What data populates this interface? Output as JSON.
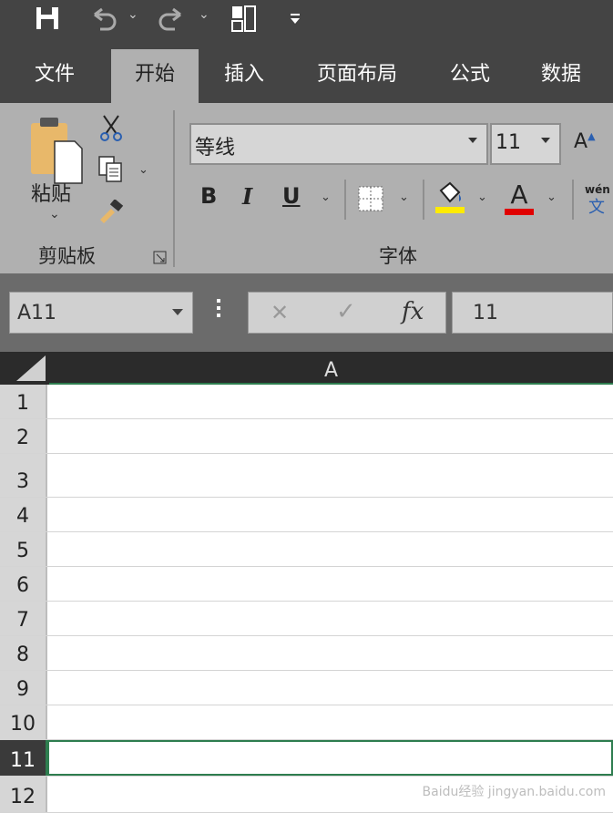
{
  "tabs": [
    {
      "label": "文件"
    },
    {
      "label": "开始"
    },
    {
      "label": "插入"
    },
    {
      "label": "页面布局"
    },
    {
      "label": "公式"
    },
    {
      "label": "数据"
    }
  ],
  "ribbon": {
    "clipboard": {
      "paste_label": "粘贴",
      "group_label": "剪贴板"
    },
    "font": {
      "font_name": "等线",
      "font_size": "11",
      "group_label": "字体",
      "bold": "B",
      "italic": "I",
      "underline": "U",
      "fill_color": "#ffeb00",
      "font_color": "#e00000",
      "font_color_letter": "A",
      "grow_font_letter": "A",
      "phonetic_top": "wén",
      "phonetic_bottom": "文"
    }
  },
  "formula_bar": {
    "name_box": "A11",
    "cancel": "✕",
    "enter": "✓",
    "fx": "fx",
    "value": "11"
  },
  "sheet": {
    "column_header": "A",
    "rows": [
      "1",
      "2",
      "3",
      "4",
      "5",
      "6",
      "7",
      "8",
      "9",
      "10",
      "11",
      "12"
    ],
    "selected_row": "11"
  },
  "watermark": "Baidu经验 jingyan.baidu.com"
}
